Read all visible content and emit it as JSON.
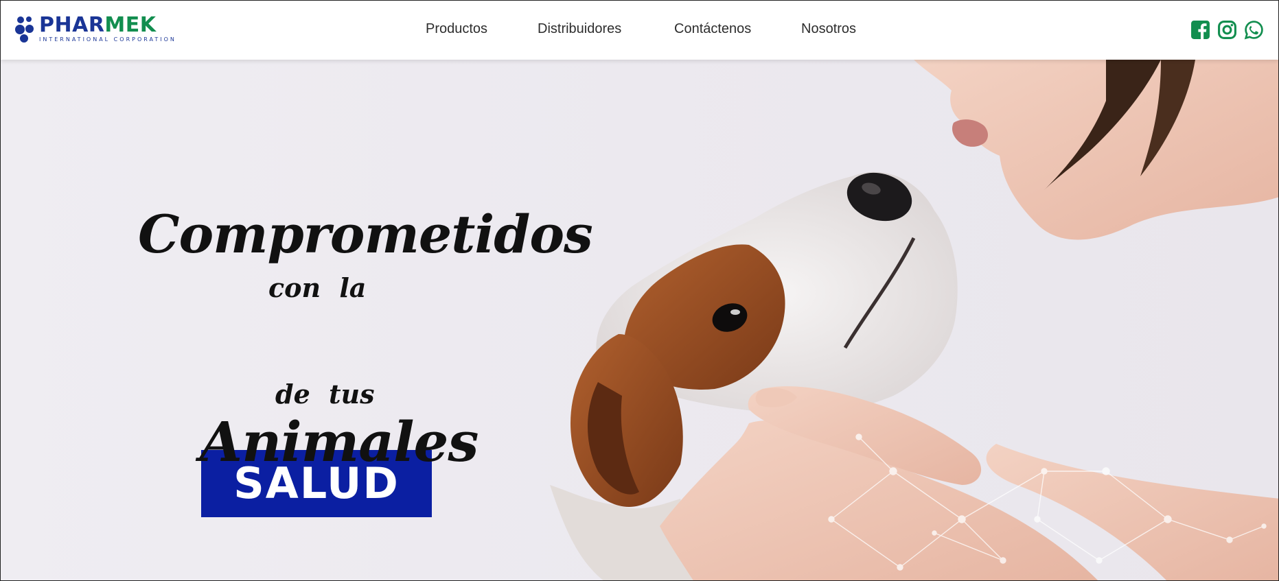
{
  "brand": {
    "name_part1": "PHAR",
    "name_part2": "MEK",
    "tagline": "INTERNATIONAL CORPORATION",
    "colors": {
      "blue": "#1a3596",
      "green": "#128e4f"
    }
  },
  "nav": {
    "items": [
      {
        "label": "Productos"
      },
      {
        "label": "Distribuidores"
      },
      {
        "label": "Contáctenos"
      },
      {
        "label": "Nosotros"
      }
    ]
  },
  "social": {
    "icons": [
      "facebook-icon",
      "instagram-icon",
      "whatsapp-icon"
    ],
    "color": "#128e4f"
  },
  "hero": {
    "line1": "Comprometidos",
    "line2": "con la",
    "highlight": "SALUD",
    "line4": "de tus",
    "line5": "Animales",
    "highlight_bg": "#0b1fa2",
    "image_subject": "woman-kissing-dog-photo"
  }
}
